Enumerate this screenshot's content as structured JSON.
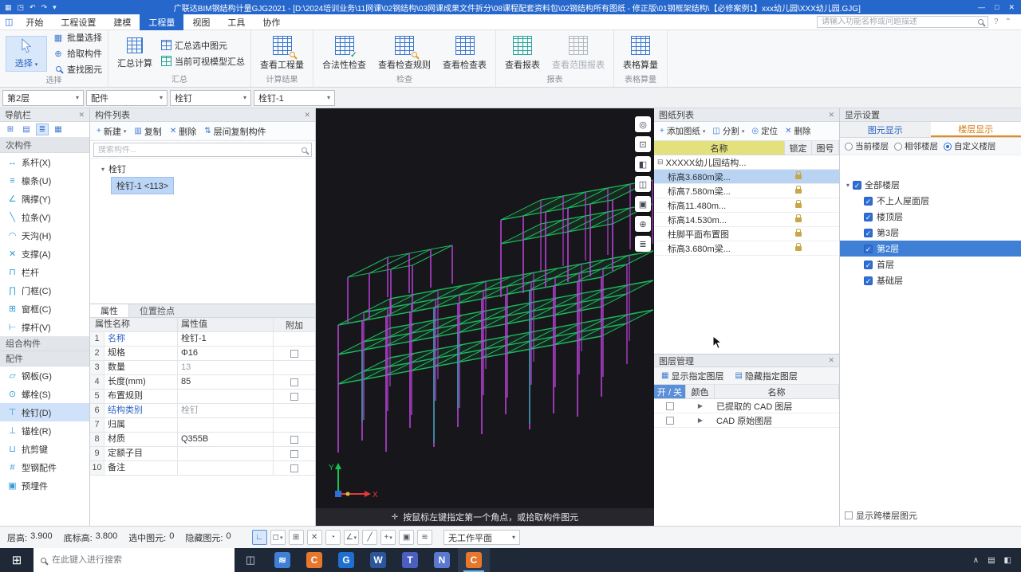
{
  "titlebar": {
    "title": "广联达BIM钢结构计量GJG2021 - [D:\\2024培训业务\\11网课\\02钢结构\\03网课成果文件拆分\\08课程配套资料包\\02钢结构所有图纸 - 修正版\\01钢框架结构\\【必修案例1】xxx幼儿园\\XXX幼儿园.GJG]"
  },
  "menubar": {
    "tabs": [
      {
        "label": "开始"
      },
      {
        "label": "工程设置"
      },
      {
        "label": "建模"
      },
      {
        "label": "工程量",
        "active": true
      },
      {
        "label": "视图"
      },
      {
        "label": "工具"
      },
      {
        "label": "协作"
      }
    ],
    "search_placeholder": "请输入功能名称或问题描述"
  },
  "ribbon": {
    "select_big": "选择",
    "batch_select": "批量选择",
    "pick_component": "拾取构件",
    "find_element": "查找图元",
    "group_select": "选择",
    "sum_calc": "汇总计算",
    "sum_selected": "汇总选中图元",
    "sum_visible": "当前可视模型汇总",
    "group_sum": "汇总",
    "view_quantity": "查看工程量",
    "group_calc_result": "计算结果",
    "legality_check": "合法性检查",
    "view_check_rules": "查看检查规则",
    "view_check_table": "查看检查表",
    "group_check": "检查",
    "view_report": "查看报表",
    "view_range_report": "查看范围报表",
    "group_report": "报表",
    "table_quantity": "表格算量",
    "group_table_quantity": "表格算量"
  },
  "selectors": {
    "floor": "第2层",
    "category": "配件",
    "family": "栓钉",
    "component": "栓钉-1"
  },
  "nav": {
    "title": "导航栏",
    "section_secondary": "次构件",
    "section_composite": "组合构件",
    "section_accessory": "配件",
    "secondary_items": [
      {
        "label": "系杆(X)",
        "glyph": "↔"
      },
      {
        "label": "檩条(U)",
        "glyph": "≡"
      },
      {
        "label": "隅撑(Y)",
        "glyph": "∠"
      },
      {
        "label": "拉条(V)",
        "glyph": "╲"
      },
      {
        "label": "天沟(H)",
        "glyph": "◠"
      },
      {
        "label": "支撑(A)",
        "glyph": "✕"
      },
      {
        "label": "栏杆",
        "glyph": "⊓"
      },
      {
        "label": "门框(C)",
        "glyph": "∏"
      },
      {
        "label": "窗框(C)",
        "glyph": "⊞"
      },
      {
        "label": "撑杆(V)",
        "glyph": "⊢"
      }
    ],
    "accessory_items": [
      {
        "label": "钢板(G)",
        "glyph": "▱"
      },
      {
        "label": "螺栓(S)",
        "glyph": "⊙"
      },
      {
        "label": "栓钉(D)",
        "glyph": "⊤",
        "selected": true
      },
      {
        "label": "锚栓(R)",
        "glyph": "⊥"
      },
      {
        "label": "抗剪键",
        "glyph": "⊔"
      },
      {
        "label": "型钢配件",
        "glyph": "#"
      },
      {
        "label": "预埋件",
        "glyph": "▣"
      }
    ]
  },
  "components": {
    "title": "构件列表",
    "toolbar": [
      {
        "label": "新建",
        "glyph": "+",
        "caret": true
      },
      {
        "label": "复制",
        "glyph": "▥"
      },
      {
        "label": "删除",
        "glyph": "✕"
      },
      {
        "label": "层间复制构件",
        "glyph": "⇅"
      }
    ],
    "search_placeholder": "搜索构件...",
    "group": "栓钉",
    "item": "栓钉-1 <113>"
  },
  "properties": {
    "tab_attr": "属性",
    "tab_pos": "位置捡点",
    "headers": [
      "属性名称",
      "属性值",
      "附加"
    ],
    "rows": [
      {
        "num": "1",
        "name": "名称",
        "value": "栓钉-1",
        "link": true,
        "nocb": true
      },
      {
        "num": "2",
        "name": "规格",
        "value": "Φ16"
      },
      {
        "num": "3",
        "name": "数量",
        "value": "13",
        "muted": true,
        "nocb": true
      },
      {
        "num": "4",
        "name": "长度(mm)",
        "value": "85"
      },
      {
        "num": "5",
        "name": "布置规则",
        "value": ""
      },
      {
        "num": "6",
        "name": "结构类别",
        "value": "栓钉",
        "link": true,
        "muted": true,
        "nocb": true
      },
      {
        "num": "7",
        "name": "归属",
        "value": "",
        "nocb": true
      },
      {
        "num": "8",
        "name": "材质",
        "value": "Q355B"
      },
      {
        "num": "9",
        "name": "定额子目",
        "value": ""
      },
      {
        "num": "10",
        "name": "备注",
        "value": ""
      }
    ]
  },
  "viewport": {
    "hint": "按鼠标左键指定第一个角点，或拾取构件图元",
    "axis_x": "X",
    "axis_y": "Y",
    "tools": [
      {
        "glyph": "◎",
        "name": "orbit"
      },
      {
        "glyph": "⊡",
        "name": "zoom-extents"
      },
      {
        "glyph": "◧",
        "name": "view-2d"
      },
      {
        "glyph": "◫",
        "name": "view-3d"
      },
      {
        "glyph": "▣",
        "name": "shaded-view"
      },
      {
        "glyph": "⊕",
        "name": "measure"
      },
      {
        "glyph": "≣",
        "name": "view-list"
      }
    ]
  },
  "drawings": {
    "title": "图纸列表",
    "toolbar": [
      {
        "label": "添加图纸",
        "glyph": "+",
        "caret": true
      },
      {
        "label": "分割",
        "glyph": "◫",
        "caret": true
      },
      {
        "label": "定位",
        "glyph": "◎"
      },
      {
        "label": "删除",
        "glyph": "✕"
      }
    ],
    "headers": {
      "name": "名称",
      "lock": "锁定",
      "no": "图号"
    },
    "rows": [
      {
        "name": "XXXXX幼儿园结构...",
        "folder": true,
        "nolock": true
      },
      {
        "name": "标高3.680m梁...",
        "child": true,
        "selected": true
      },
      {
        "name": "标高7.580m梁...",
        "child": true
      },
      {
        "name": "标高11.480m...",
        "child": true
      },
      {
        "name": "标高14.530m...",
        "child": true
      },
      {
        "name": "柱脚平面布置图",
        "child": true
      },
      {
        "name": "标高3.680m梁...",
        "child": true
      }
    ]
  },
  "layers": {
    "title": "图层管理",
    "btn_show": "显示指定图层",
    "btn_hide": "隐藏指定图层",
    "headers": {
      "onoff": "开 / 关",
      "color": "颜色",
      "name": "名称"
    },
    "rows": [
      {
        "name": "已提取的 CAD 图层"
      },
      {
        "name": "CAD 原始图层"
      }
    ]
  },
  "display": {
    "title": "显示设置",
    "tab_element": "图元显示",
    "tab_floor": "楼层显示",
    "radios": [
      {
        "label": "当前楼层"
      },
      {
        "label": "相邻楼层"
      },
      {
        "label": "自定义楼层",
        "checked": true
      }
    ],
    "root": "全部楼层",
    "floors": [
      {
        "label": "不上人屋面层"
      },
      {
        "label": "楼顶层"
      },
      {
        "label": "第3层"
      },
      {
        "label": "第2层",
        "selected": true
      },
      {
        "label": "首层"
      },
      {
        "label": "基础层"
      }
    ],
    "footer": "显示跨楼层图元"
  },
  "statusbar": {
    "items": [
      {
        "label": "层高:",
        "value": "3.900"
      },
      {
        "label": "底标高:",
        "value": "3.800"
      },
      {
        "label": "选中图元:",
        "value": "0"
      },
      {
        "label": "隐藏图元:",
        "value": "0"
      }
    ],
    "tools": [
      {
        "glyph": "∟",
        "active": true
      },
      {
        "glyph": "◻",
        "caret": true
      },
      {
        "glyph": "⊞"
      },
      {
        "glyph": "✕"
      },
      {
        "glyph": "◔"
      },
      {
        "glyph": "∠",
        "caret": true
      },
      {
        "glyph": "╱"
      },
      {
        "glyph": "+",
        "caret": true
      },
      {
        "glyph": "▣"
      },
      {
        "glyph": "≋"
      }
    ],
    "workplane": "无工作平面"
  },
  "taskbar": {
    "search_placeholder": "在此键入进行搜索",
    "apps": [
      {
        "glyph": "≋",
        "color": "#3f7fd6"
      },
      {
        "glyph": "C",
        "color": "#e8772e"
      },
      {
        "glyph": "G",
        "color": "#1f6fd0"
      },
      {
        "glyph": "W",
        "color": "#2b579a"
      },
      {
        "glyph": "T",
        "color": "#4a5fc0"
      },
      {
        "glyph": "N",
        "color": "#5a78d0"
      },
      {
        "glyph": "C",
        "color": "#e8772e",
        "active": true
      }
    ]
  }
}
